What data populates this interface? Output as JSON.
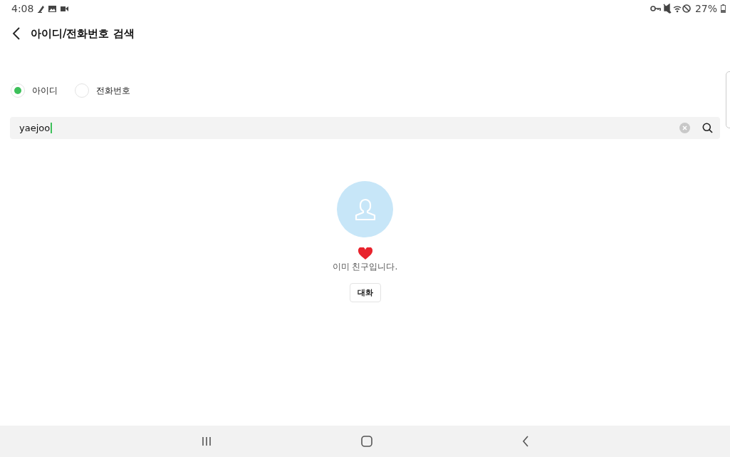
{
  "status_bar": {
    "time": "4:08",
    "battery": "27%"
  },
  "header": {
    "title": "아이디/전화번호 검색"
  },
  "search_type": [
    {
      "label": "아이디",
      "selected": true
    },
    {
      "label": "전화번호",
      "selected": false
    }
  ],
  "search": {
    "value": "yaejoo"
  },
  "result": {
    "message": "이미 친구입니다.",
    "button": "대화"
  }
}
